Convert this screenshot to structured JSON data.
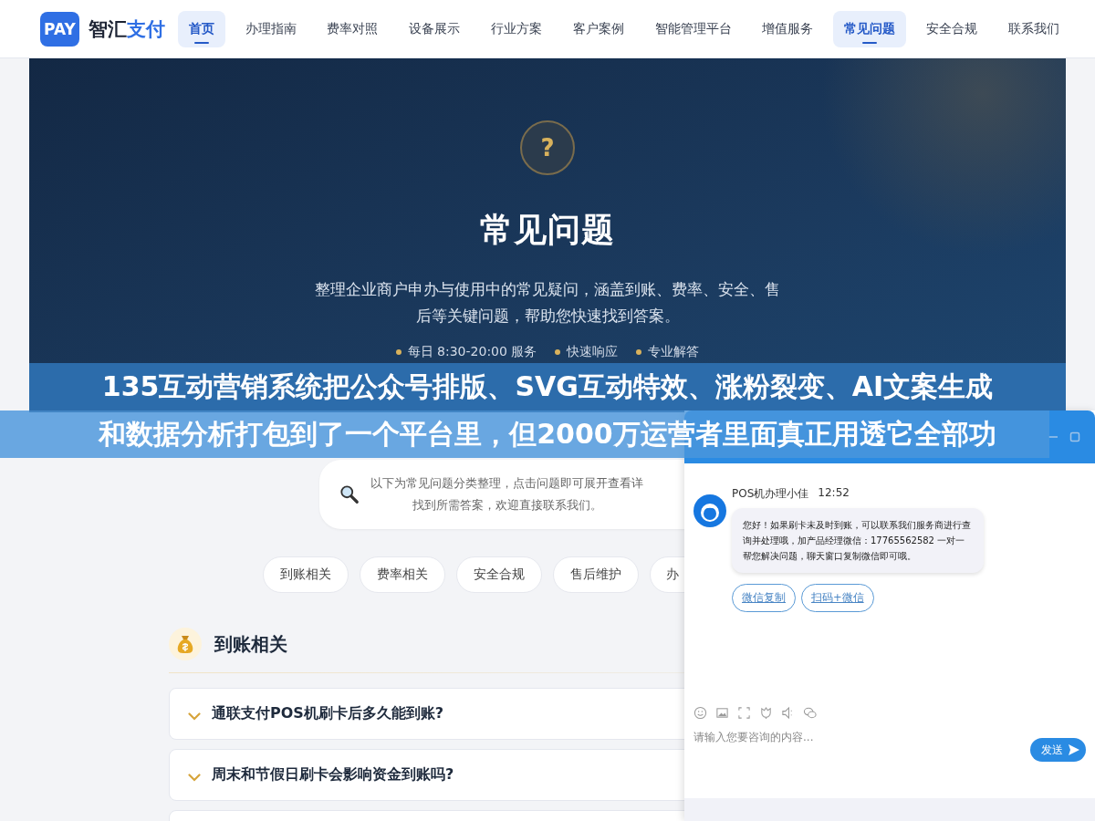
{
  "nav": {
    "logo_badge": "PAY",
    "logo_text": "智汇",
    "logo_accent": "支付",
    "items": [
      {
        "label": "首页",
        "selected": true
      },
      {
        "label": "办理指南",
        "selected": false
      },
      {
        "label": "费率对照",
        "selected": false
      },
      {
        "label": "设备展示",
        "selected": false
      },
      {
        "label": "行业方案",
        "selected": false
      },
      {
        "label": "客户案例",
        "selected": false
      },
      {
        "label": "智能管理平台",
        "selected": false
      },
      {
        "label": "增值服务",
        "selected": false
      },
      {
        "label": "常见问题",
        "selected": true
      },
      {
        "label": "安全合规",
        "selected": false
      },
      {
        "label": "联系我们",
        "selected": false
      }
    ]
  },
  "hero": {
    "icon": "?",
    "title": "常见问题",
    "description": "整理企业商户申办与使用中的常见疑问，涵盖到账、费率、安全、售后等关键问题，帮助您快速找到答案。",
    "features": [
      "每日 8:30-20:00 服务",
      "快速响应",
      "专业解答"
    ]
  },
  "caption": {
    "lines": [
      "135互动营销系统把公众号排版、SVG互动特效、涨粉裂变、AI文案生成",
      "和数据分析打包到了一个平台里，但2000万运营者里面真正用透它全部功"
    ]
  },
  "intro": {
    "line_1": "以下为常见问题分类整理，点击问题即可展开查看详",
    "line_2": "找到所需答案，欢迎直接联系我们。"
  },
  "categories": [
    "到账相关",
    "费率相关",
    "安全合规",
    "售后维护",
    "办"
  ],
  "section": {
    "title": "到账相关",
    "faqs": [
      {
        "question": "通联支付POS机刷卡后多久能到账?"
      },
      {
        "question": "周末和节假日刷卡会影响资金到账吗?"
      }
    ]
  },
  "chat": {
    "agent_name": "POS机办理小佳",
    "time": "12:52",
    "message": "您好！如果刷卡未及时到账，可以联系我们服务商进行查询并处理哦，加产品经理微信：17765562582 一对一帮您解决问题，聊天窗口复制微信即可哦。",
    "actions": [
      "微信复制",
      "扫码+微信"
    ],
    "input": {
      "placeholder": "请输入您要咨询的内容..."
    },
    "send_label": "发送"
  }
}
